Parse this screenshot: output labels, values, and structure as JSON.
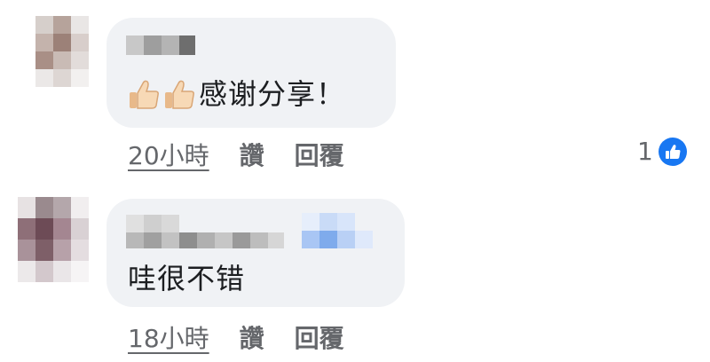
{
  "comments": [
    {
      "text": "感谢分享！",
      "emoji": [
        "thumbs-up-icon",
        "thumbs-up-icon"
      ],
      "time": "20小時",
      "like_label": "讚",
      "reply_label": "回覆",
      "reaction_count": "1"
    },
    {
      "text": "哇很不错",
      "time": "18小時",
      "like_label": "讚",
      "reply_label": "回覆"
    }
  ],
  "colors": {
    "bubble": "#f0f2f5",
    "text": "#1c1e21",
    "meta": "#65676b",
    "like_blue": "#1877f2"
  }
}
